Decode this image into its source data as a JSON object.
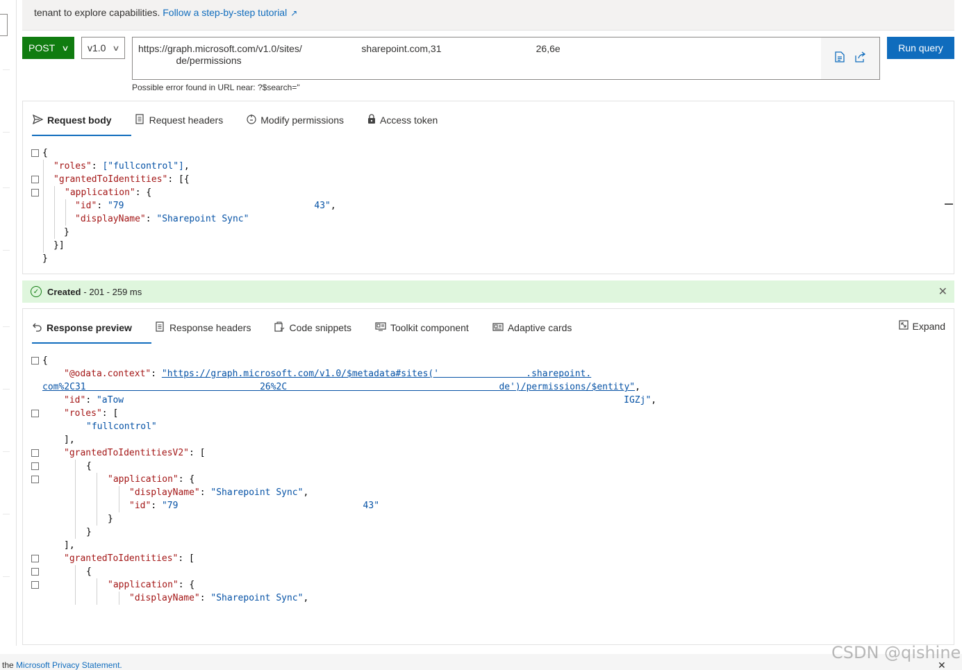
{
  "banner": {
    "text": "tenant to explore capabilities.",
    "link": "Follow a step-by-step tutorial"
  },
  "query": {
    "method": "POST",
    "version": "v1.0",
    "url_line1": "https://graph.microsoft.com/v1.0/sites/                      sharepoint.com,31                                   26,6e",
    "url_line2": "              de/permissions",
    "run_label": "Run query",
    "error": "Possible error found in URL near: ?$search=\""
  },
  "request_tabs": [
    {
      "label": "Request body",
      "icon": "send-icon"
    },
    {
      "label": "Request headers",
      "icon": "document-icon"
    },
    {
      "label": "Modify permissions",
      "icon": "shield-icon"
    },
    {
      "label": "Access token",
      "icon": "lock-icon"
    }
  ],
  "request_body": {
    "l1": "{",
    "roles_key": "\"roles\"",
    "roles_val": "[\"fullcontrol\"]",
    "gti_key": "\"grantedToIdentities\"",
    "gti_open": ": [{",
    "app_key": "\"application\"",
    "app_open": ": {",
    "id_key": "\"id\"",
    "id_val": "\"79                                   43\"",
    "dn_key": "\"displayName\"",
    "dn_val": "\"Sharepoint Sync\"",
    "close_app": "}",
    "close_gti": "}]",
    "close_root": "}"
  },
  "status": {
    "label": "Created",
    "detail": "- 201 - 259 ms"
  },
  "response_tabs": [
    {
      "label": "Response preview",
      "icon": "undo-icon"
    },
    {
      "label": "Response headers",
      "icon": "document-icon"
    },
    {
      "label": "Code snippets",
      "icon": "code-icon"
    },
    {
      "label": "Toolkit component",
      "icon": "toolkit-icon"
    },
    {
      "label": "Adaptive cards",
      "icon": "card-icon"
    }
  ],
  "expand_label": "Expand",
  "response": {
    "open": "{",
    "ctx_key": "\"@odata.context\"",
    "ctx_val1": "\"https://graph.microsoft.com/v1.0/$metadata#sites('                .sharepoint.",
    "ctx_val2": "com%2C31                                26%2C                                       de')/permissions/$entity\"",
    "id_key": "\"id\"",
    "id_val": "\"aTow                                                                                            IGZj\"",
    "roles_key": "\"roles\"",
    "roles_open": ": [",
    "roles_item": "\"fullcontrol\"",
    "roles_close": "],",
    "v2_key": "\"grantedToIdentitiesV2\"",
    "v2_open": ": [",
    "obj_open": "{",
    "app_key": "\"application\"",
    "app_open": ": {",
    "dn_key": "\"displayName\"",
    "dn_val": "\"Sharepoint Sync\"",
    "id2_key": "\"id\"",
    "id2_val": "\"79                                  43\"",
    "close_app": "}",
    "close_obj": "}",
    "close_arr": "],",
    "gti_key": "\"grantedToIdentities\"",
    "gti_open": ": [",
    "obj2_open": "{",
    "app2_key": "\"application\"",
    "app2_open": ": {",
    "dn2_key": "\"displayName\"",
    "dn2_val": "\"Sharepoint Sync\""
  },
  "footer": {
    "prefix": "the",
    "link": "Microsoft Privacy Statement."
  },
  "watermark": "CSDN @qishine",
  "colors": {
    "post_green": "#107c10",
    "accent_blue": "#0f6cbd",
    "json_key": "#a31515",
    "json_string": "#0451a5",
    "success_bg": "#dff6dd"
  }
}
